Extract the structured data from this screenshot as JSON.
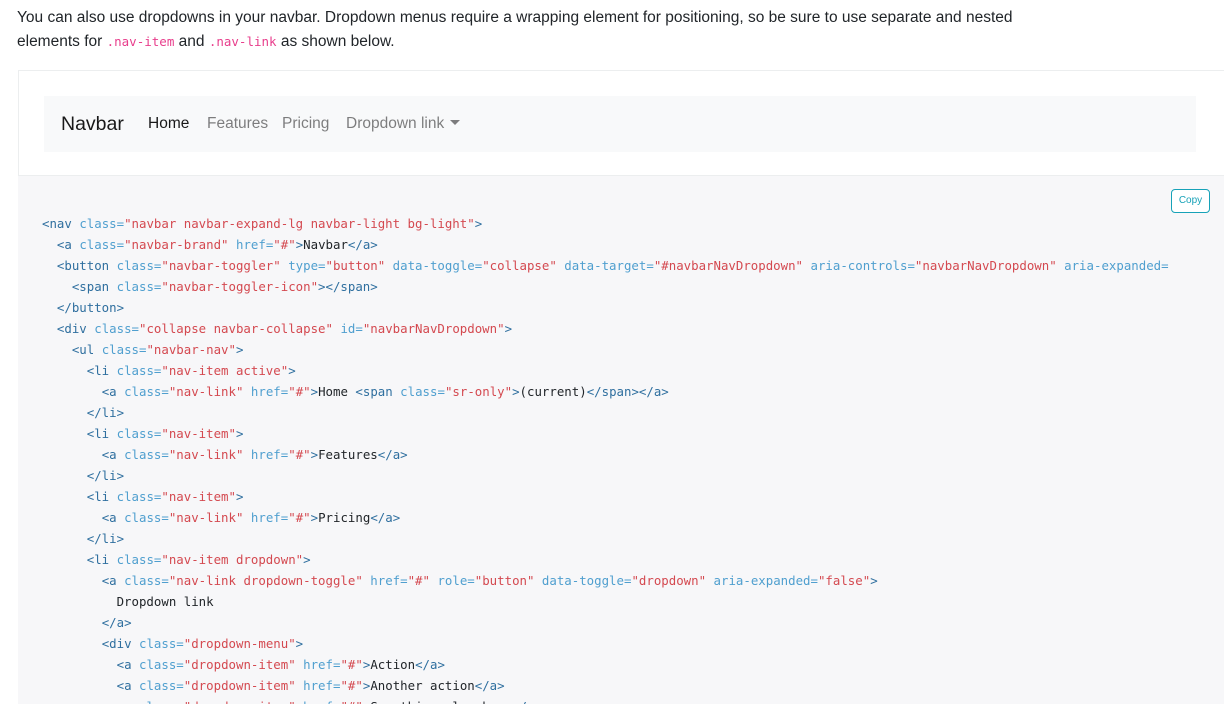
{
  "intro": {
    "text_before": "You can also use dropdowns in your navbar. Dropdown menus require a wrapping element for positioning, so be sure to use separate and nested elements for ",
    "code1": ".nav-item",
    "text_mid": " and ",
    "code2": ".nav-link",
    "text_after": " as shown below."
  },
  "navbar": {
    "brand": "Navbar",
    "links": [
      "Home",
      "Features",
      "Pricing",
      "Dropdown link"
    ]
  },
  "copy_button": {
    "label": "Copy"
  },
  "colors": {
    "tag": "#2f6f9f",
    "attribute": "#4f9fcf",
    "string": "#d44950",
    "inline_code": "#e83e8c",
    "copy_button": "#17a2b8",
    "code_background": "#f7f7f9",
    "navbar_background": "#f8f9fa"
  },
  "code_lines": [
    [
      [
        "tg",
        "<nav "
      ],
      [
        "at",
        "class="
      ],
      [
        "st",
        "\"navbar navbar-expand-lg navbar-light bg-light\""
      ],
      [
        "tg",
        ">"
      ]
    ],
    [
      [
        "tx",
        "  "
      ],
      [
        "tg",
        "<a "
      ],
      [
        "at",
        "class="
      ],
      [
        "st",
        "\"navbar-brand\""
      ],
      [
        "tx",
        " "
      ],
      [
        "at",
        "href="
      ],
      [
        "st",
        "\"#\""
      ],
      [
        "tg",
        ">"
      ],
      [
        "tx",
        "Navbar"
      ],
      [
        "tg",
        "</a>"
      ]
    ],
    [
      [
        "tx",
        "  "
      ],
      [
        "tg",
        "<button "
      ],
      [
        "at",
        "class="
      ],
      [
        "st",
        "\"navbar-toggler\""
      ],
      [
        "tx",
        " "
      ],
      [
        "at",
        "type="
      ],
      [
        "st",
        "\"button\""
      ],
      [
        "tx",
        " "
      ],
      [
        "at",
        "data-toggle="
      ],
      [
        "st",
        "\"collapse\""
      ],
      [
        "tx",
        " "
      ],
      [
        "at",
        "data-target="
      ],
      [
        "st",
        "\"#navbarNavDropdown\""
      ],
      [
        "tx",
        " "
      ],
      [
        "at",
        "aria-controls="
      ],
      [
        "st",
        "\"navbarNavDropdown\""
      ],
      [
        "tx",
        " "
      ],
      [
        "at",
        "aria-expanded="
      ]
    ],
    [
      [
        "tx",
        "    "
      ],
      [
        "tg",
        "<span "
      ],
      [
        "at",
        "class="
      ],
      [
        "st",
        "\"navbar-toggler-icon\""
      ],
      [
        "tg",
        "></span>"
      ]
    ],
    [
      [
        "tx",
        "  "
      ],
      [
        "tg",
        "</button>"
      ]
    ],
    [
      [
        "tx",
        "  "
      ],
      [
        "tg",
        "<div "
      ],
      [
        "at",
        "class="
      ],
      [
        "st",
        "\"collapse navbar-collapse\""
      ],
      [
        "tx",
        " "
      ],
      [
        "at",
        "id="
      ],
      [
        "st",
        "\"navbarNavDropdown\""
      ],
      [
        "tg",
        ">"
      ]
    ],
    [
      [
        "tx",
        "    "
      ],
      [
        "tg",
        "<ul "
      ],
      [
        "at",
        "class="
      ],
      [
        "st",
        "\"navbar-nav\""
      ],
      [
        "tg",
        ">"
      ]
    ],
    [
      [
        "tx",
        "      "
      ],
      [
        "tg",
        "<li "
      ],
      [
        "at",
        "class="
      ],
      [
        "st",
        "\"nav-item active\""
      ],
      [
        "tg",
        ">"
      ]
    ],
    [
      [
        "tx",
        "        "
      ],
      [
        "tg",
        "<a "
      ],
      [
        "at",
        "class="
      ],
      [
        "st",
        "\"nav-link\""
      ],
      [
        "tx",
        " "
      ],
      [
        "at",
        "href="
      ],
      [
        "st",
        "\"#\""
      ],
      [
        "tg",
        ">"
      ],
      [
        "tx",
        "Home "
      ],
      [
        "tg",
        "<span "
      ],
      [
        "at",
        "class="
      ],
      [
        "st",
        "\"sr-only\""
      ],
      [
        "tg",
        ">"
      ],
      [
        "tx",
        "(current)"
      ],
      [
        "tg",
        "</span></a>"
      ]
    ],
    [
      [
        "tx",
        "      "
      ],
      [
        "tg",
        "</li>"
      ]
    ],
    [
      [
        "tx",
        "      "
      ],
      [
        "tg",
        "<li "
      ],
      [
        "at",
        "class="
      ],
      [
        "st",
        "\"nav-item\""
      ],
      [
        "tg",
        ">"
      ]
    ],
    [
      [
        "tx",
        "        "
      ],
      [
        "tg",
        "<a "
      ],
      [
        "at",
        "class="
      ],
      [
        "st",
        "\"nav-link\""
      ],
      [
        "tx",
        " "
      ],
      [
        "at",
        "href="
      ],
      [
        "st",
        "\"#\""
      ],
      [
        "tg",
        ">"
      ],
      [
        "tx",
        "Features"
      ],
      [
        "tg",
        "</a>"
      ]
    ],
    [
      [
        "tx",
        "      "
      ],
      [
        "tg",
        "</li>"
      ]
    ],
    [
      [
        "tx",
        "      "
      ],
      [
        "tg",
        "<li "
      ],
      [
        "at",
        "class="
      ],
      [
        "st",
        "\"nav-item\""
      ],
      [
        "tg",
        ">"
      ]
    ],
    [
      [
        "tx",
        "        "
      ],
      [
        "tg",
        "<a "
      ],
      [
        "at",
        "class="
      ],
      [
        "st",
        "\"nav-link\""
      ],
      [
        "tx",
        " "
      ],
      [
        "at",
        "href="
      ],
      [
        "st",
        "\"#\""
      ],
      [
        "tg",
        ">"
      ],
      [
        "tx",
        "Pricing"
      ],
      [
        "tg",
        "</a>"
      ]
    ],
    [
      [
        "tx",
        "      "
      ],
      [
        "tg",
        "</li>"
      ]
    ],
    [
      [
        "tx",
        "      "
      ],
      [
        "tg",
        "<li "
      ],
      [
        "at",
        "class="
      ],
      [
        "st",
        "\"nav-item dropdown\""
      ],
      [
        "tg",
        ">"
      ]
    ],
    [
      [
        "tx",
        "        "
      ],
      [
        "tg",
        "<a "
      ],
      [
        "at",
        "class="
      ],
      [
        "st",
        "\"nav-link dropdown-toggle\""
      ],
      [
        "tx",
        " "
      ],
      [
        "at",
        "href="
      ],
      [
        "st",
        "\"#\""
      ],
      [
        "tx",
        " "
      ],
      [
        "at",
        "role="
      ],
      [
        "st",
        "\"button\""
      ],
      [
        "tx",
        " "
      ],
      [
        "at",
        "data-toggle="
      ],
      [
        "st",
        "\"dropdown\""
      ],
      [
        "tx",
        " "
      ],
      [
        "at",
        "aria-expanded="
      ],
      [
        "st",
        "\"false\""
      ],
      [
        "tg",
        ">"
      ]
    ],
    [
      [
        "tx",
        "          Dropdown link"
      ]
    ],
    [
      [
        "tx",
        "        "
      ],
      [
        "tg",
        "</a>"
      ]
    ],
    [
      [
        "tx",
        "        "
      ],
      [
        "tg",
        "<div "
      ],
      [
        "at",
        "class="
      ],
      [
        "st",
        "\"dropdown-menu\""
      ],
      [
        "tg",
        ">"
      ]
    ],
    [
      [
        "tx",
        "          "
      ],
      [
        "tg",
        "<a "
      ],
      [
        "at",
        "class="
      ],
      [
        "st",
        "\"dropdown-item\""
      ],
      [
        "tx",
        " "
      ],
      [
        "at",
        "href="
      ],
      [
        "st",
        "\"#\""
      ],
      [
        "tg",
        ">"
      ],
      [
        "tx",
        "Action"
      ],
      [
        "tg",
        "</a>"
      ]
    ],
    [
      [
        "tx",
        "          "
      ],
      [
        "tg",
        "<a "
      ],
      [
        "at",
        "class="
      ],
      [
        "st",
        "\"dropdown-item\""
      ],
      [
        "tx",
        " "
      ],
      [
        "at",
        "href="
      ],
      [
        "st",
        "\"#\""
      ],
      [
        "tg",
        ">"
      ],
      [
        "tx",
        "Another action"
      ],
      [
        "tg",
        "</a>"
      ]
    ],
    [
      [
        "tx",
        "          "
      ],
      [
        "tg",
        "<a "
      ],
      [
        "at",
        "class="
      ],
      [
        "st",
        "\"dropdown-item\""
      ],
      [
        "tx",
        " "
      ],
      [
        "at",
        "href="
      ],
      [
        "st",
        "\"#\""
      ],
      [
        "tg",
        ">"
      ],
      [
        "tx",
        "Something else here"
      ],
      [
        "tg",
        "</a>"
      ]
    ]
  ]
}
